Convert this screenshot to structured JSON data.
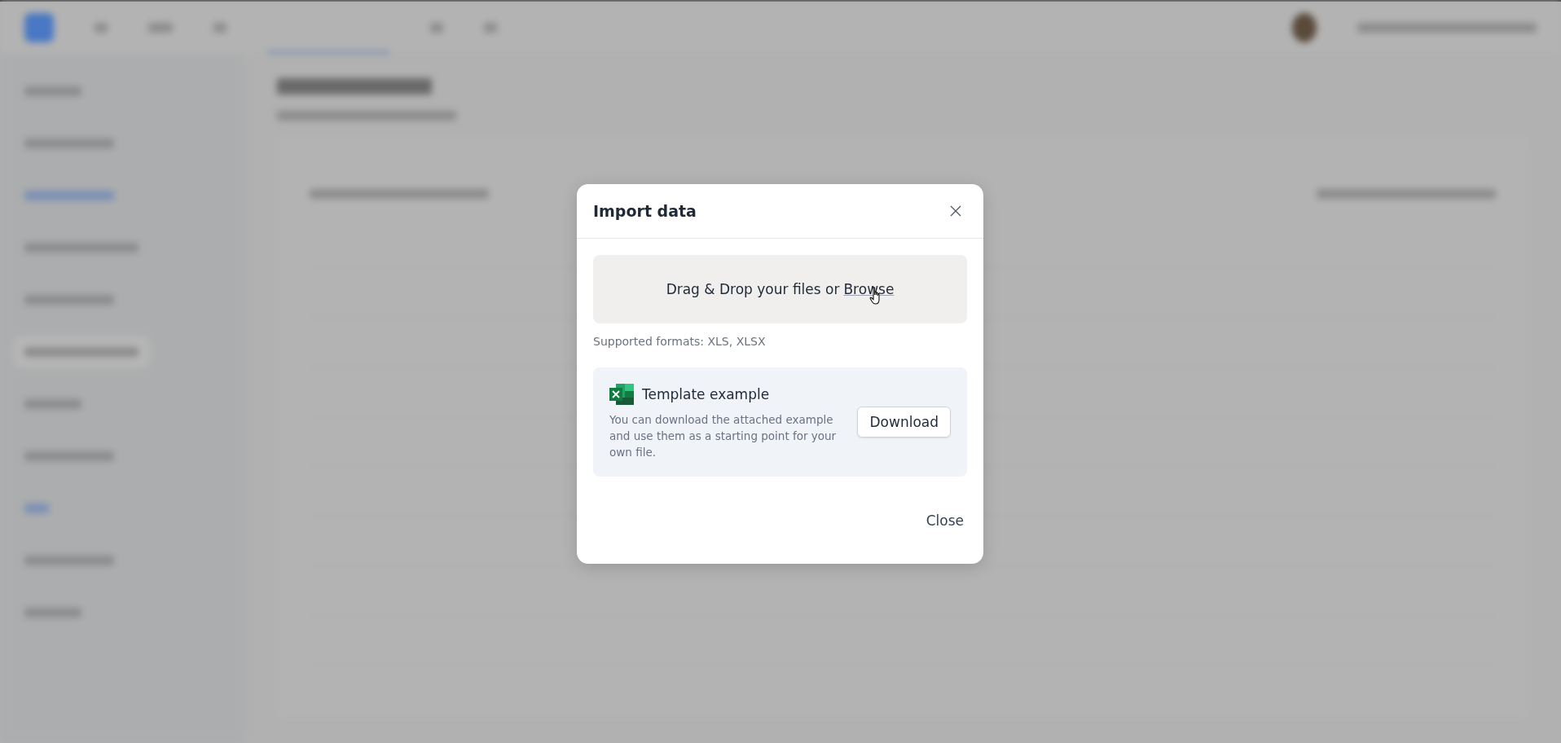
{
  "dialog": {
    "title": "Import data",
    "dropzone": {
      "text": "Drag & Drop your files or",
      "link": "Browse"
    },
    "supported_formats": "Supported formats: XLS, XLSX",
    "template": {
      "title": "Template example",
      "description": "You can download the attached example and use them as a starting point for your own file.",
      "button": "Download"
    },
    "footer_button": "Close"
  }
}
